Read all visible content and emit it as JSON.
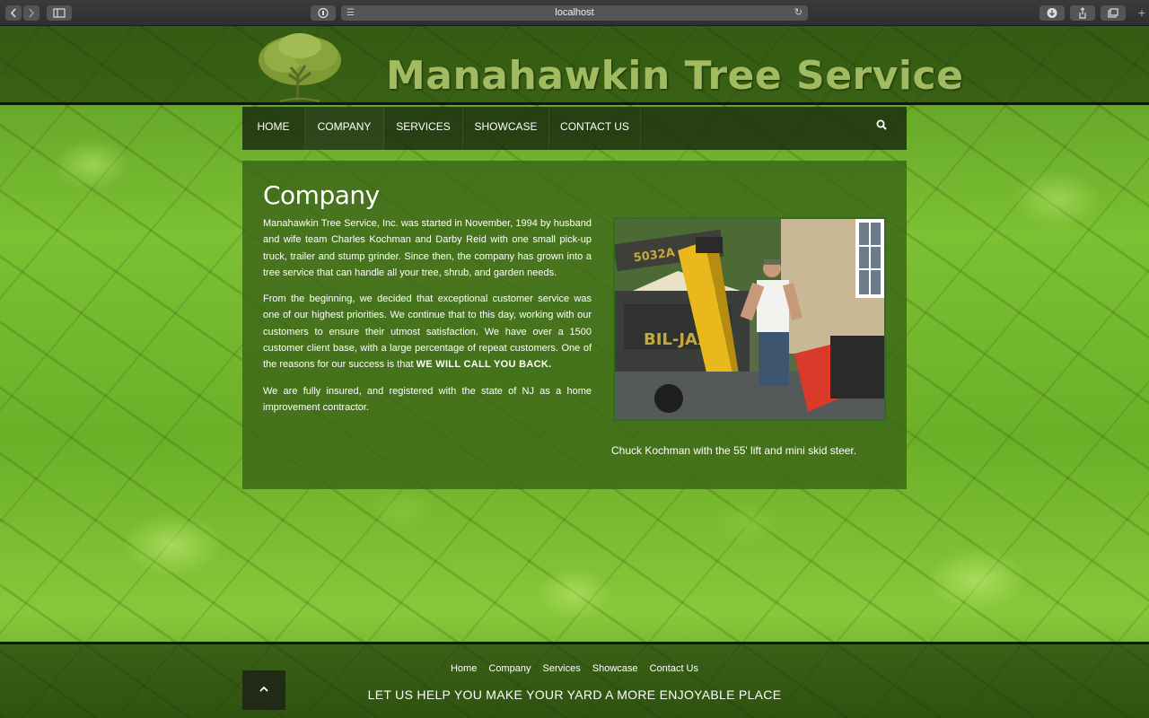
{
  "browser": {
    "url": "localhost",
    "back_icon": "chevron-left-icon",
    "forward_icon": "chevron-right-icon"
  },
  "site": {
    "title": "Manahawkin Tree Service"
  },
  "nav": {
    "items": [
      {
        "label": "HOME"
      },
      {
        "label": "COMPANY"
      },
      {
        "label": "SERVICES"
      },
      {
        "label": "SHOWCASE"
      },
      {
        "label": "CONTACT US"
      }
    ],
    "active": "COMPANY"
  },
  "main": {
    "heading": "Company",
    "paragraphs": [
      "Manahawkin Tree Service, Inc. was started in November, 1994 by husband and wife team Charles Kochman and Darby Reid with one small pick-up truck, trailer and stump grinder. Since then, the company has grown into a tree service that can handle all your tree, shrub, and garden needs.",
      "From the beginning, we decided that exceptional customer service was one of our highest priorities. We continue that to this day, working with our customers to ensure their utmost satisfaction. We have over a 1500 customer client base, with a large percentage of repeat customers. One of the reasons for our success is that",
      "We are fully insured, and registered with the state of NJ as a home improvement contractor."
    ],
    "emphasis": "WE WILL CALL YOU BACK.",
    "photo_labels": {
      "machine_brand": "BIL-JAX",
      "machine_side": "5032A"
    },
    "caption": "Chuck Kochman with the 55' lift and mini skid steer."
  },
  "footer": {
    "links": [
      "Home",
      "Company",
      "Services",
      "Showcase",
      "Contact Us"
    ],
    "tagline": "LET US HELP YOU MAKE YOUR YARD A MORE ENJOYABLE PLACE"
  },
  "colors": {
    "title": "#a3bb60",
    "nav_bg": "#19280f",
    "content_bg": "#3c6419"
  }
}
